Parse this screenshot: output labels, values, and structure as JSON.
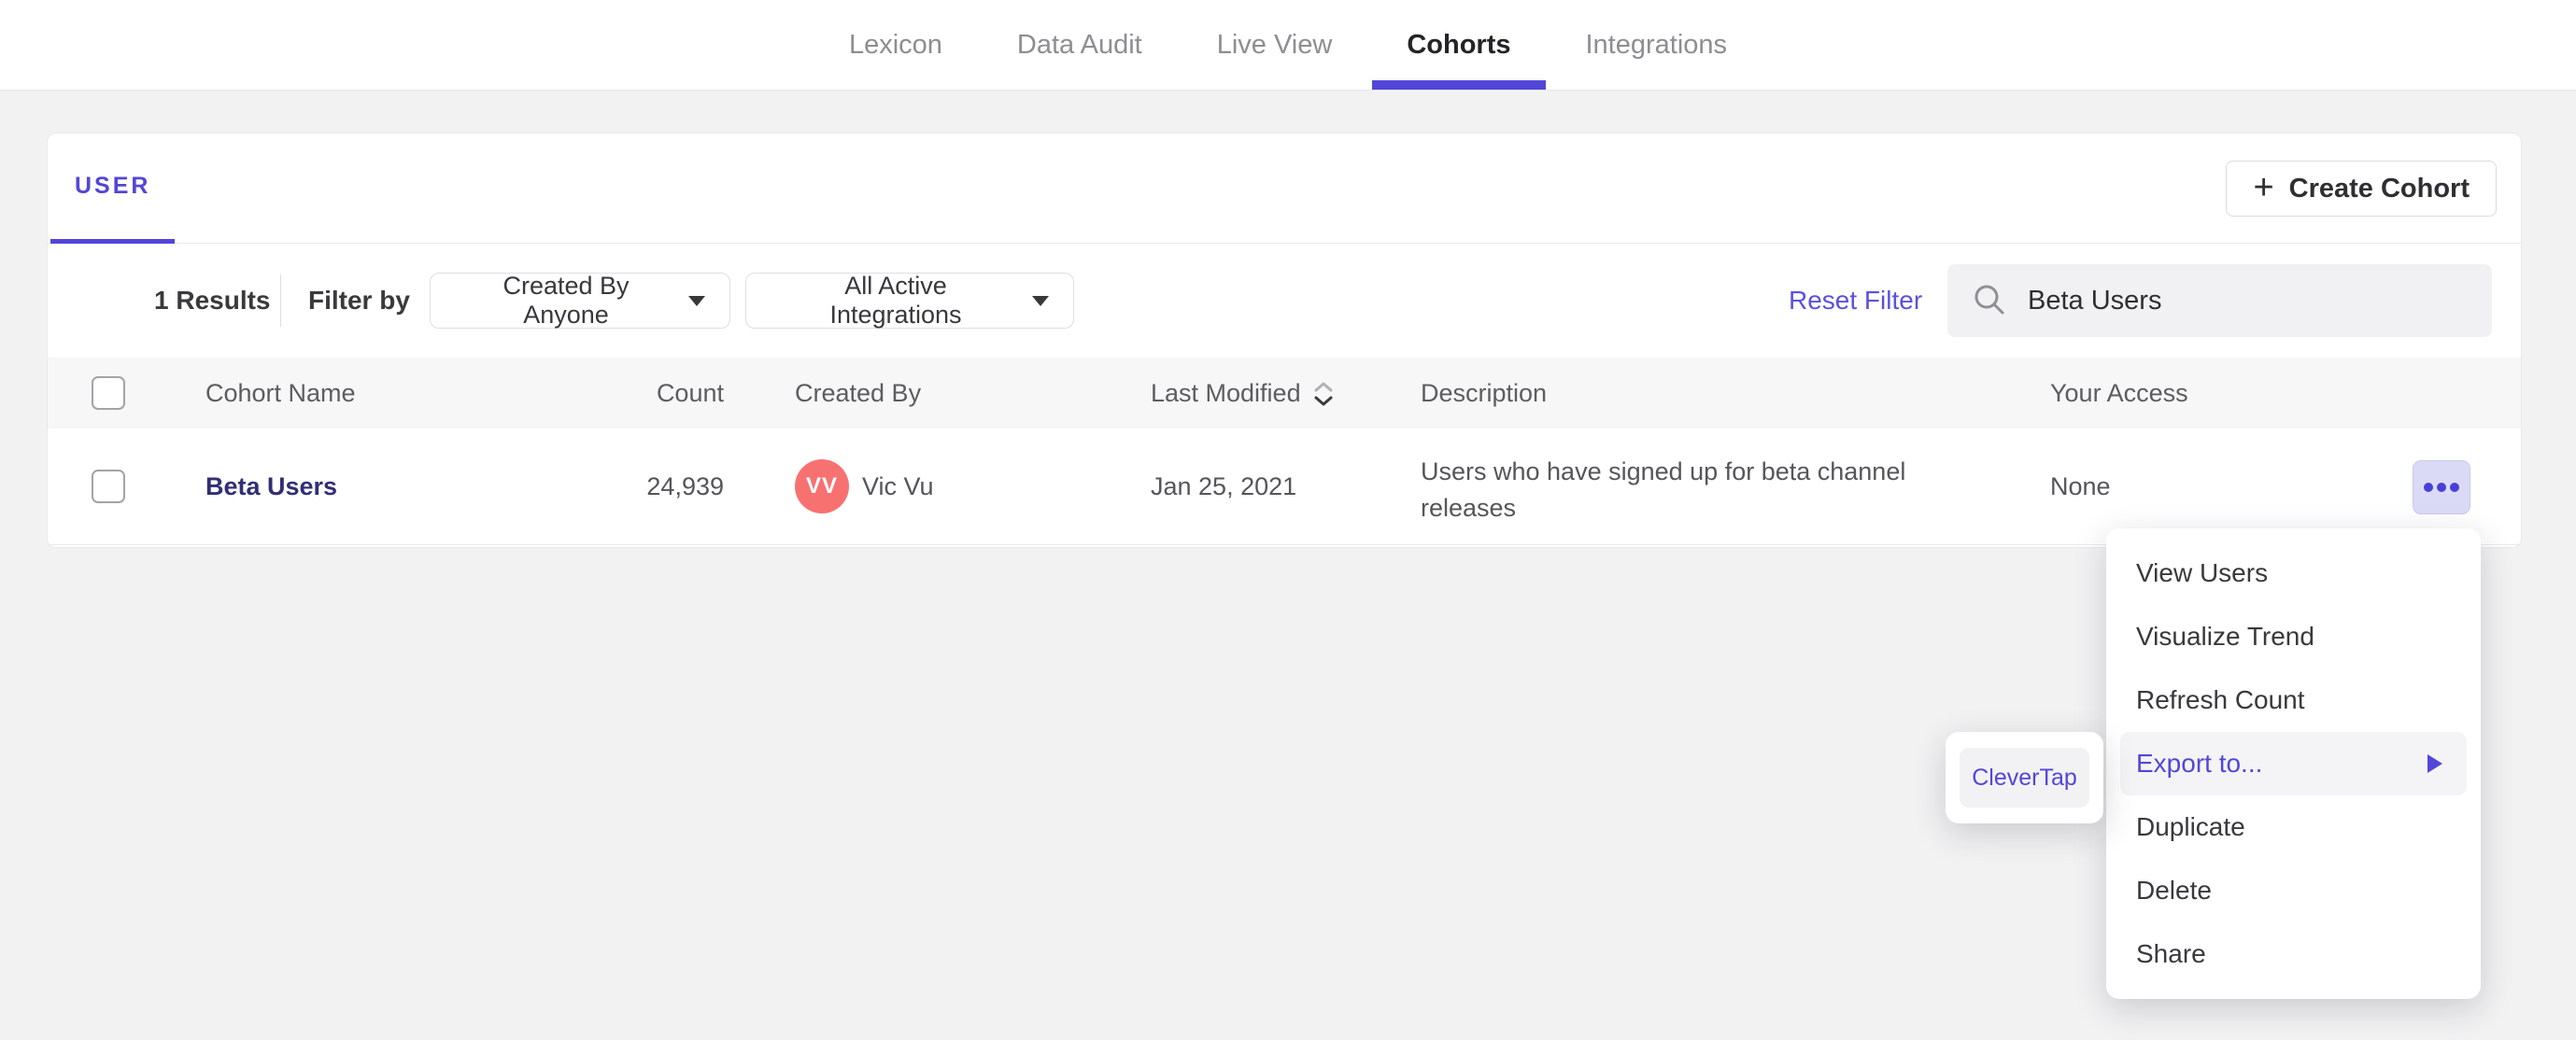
{
  "nav": {
    "tabs": [
      {
        "label": "Lexicon"
      },
      {
        "label": "Data Audit"
      },
      {
        "label": "Live View"
      },
      {
        "label": "Cohorts"
      },
      {
        "label": "Integrations"
      }
    ],
    "active_tab": "Cohorts"
  },
  "cohorts_card": {
    "tab_label": "USER",
    "create_button": {
      "plus": "+",
      "label": "Create Cohort"
    },
    "filters": {
      "results_count": "1 Results",
      "filter_by_label": "Filter by",
      "created_by_dropdown": "Created By Anyone",
      "integrations_dropdown": "All Active Integrations",
      "reset_label": "Reset Filter",
      "search_value": "Beta Users"
    },
    "table": {
      "columns": {
        "name": "Cohort Name",
        "count": "Count",
        "created_by": "Created By",
        "last_modified": "Last Modified",
        "description": "Description",
        "access": "Your Access"
      },
      "row": {
        "name": "Beta Users",
        "count": "24,939",
        "avatar_initials": "VV",
        "created_by": "Vic Vu",
        "last_modified": "Jan 25, 2021",
        "description": "Users who have signed up for beta channel releases",
        "access": "None"
      }
    }
  },
  "context_menu": {
    "items": [
      {
        "label": "View Users"
      },
      {
        "label": "Visualize Trend"
      },
      {
        "label": "Refresh Count"
      },
      {
        "label": "Export to...",
        "highlighted": true,
        "has_submenu": true
      },
      {
        "label": "Duplicate"
      },
      {
        "label": "Delete"
      },
      {
        "label": "Share"
      }
    ],
    "submenu": {
      "items": [
        {
          "label": "CleverTap"
        }
      ]
    }
  },
  "colors": {
    "accent_purple": "#5246d9",
    "cohort_link": "#322e75",
    "avatar_coral": "#f77171",
    "page_bg": "#f2f2f3",
    "table_header_bg": "#f7f7f8",
    "menu_highlight_bg": "#f4f4f6",
    "actions_button_bg": "#dbdaf6",
    "reset_link": "#5b51dc"
  }
}
